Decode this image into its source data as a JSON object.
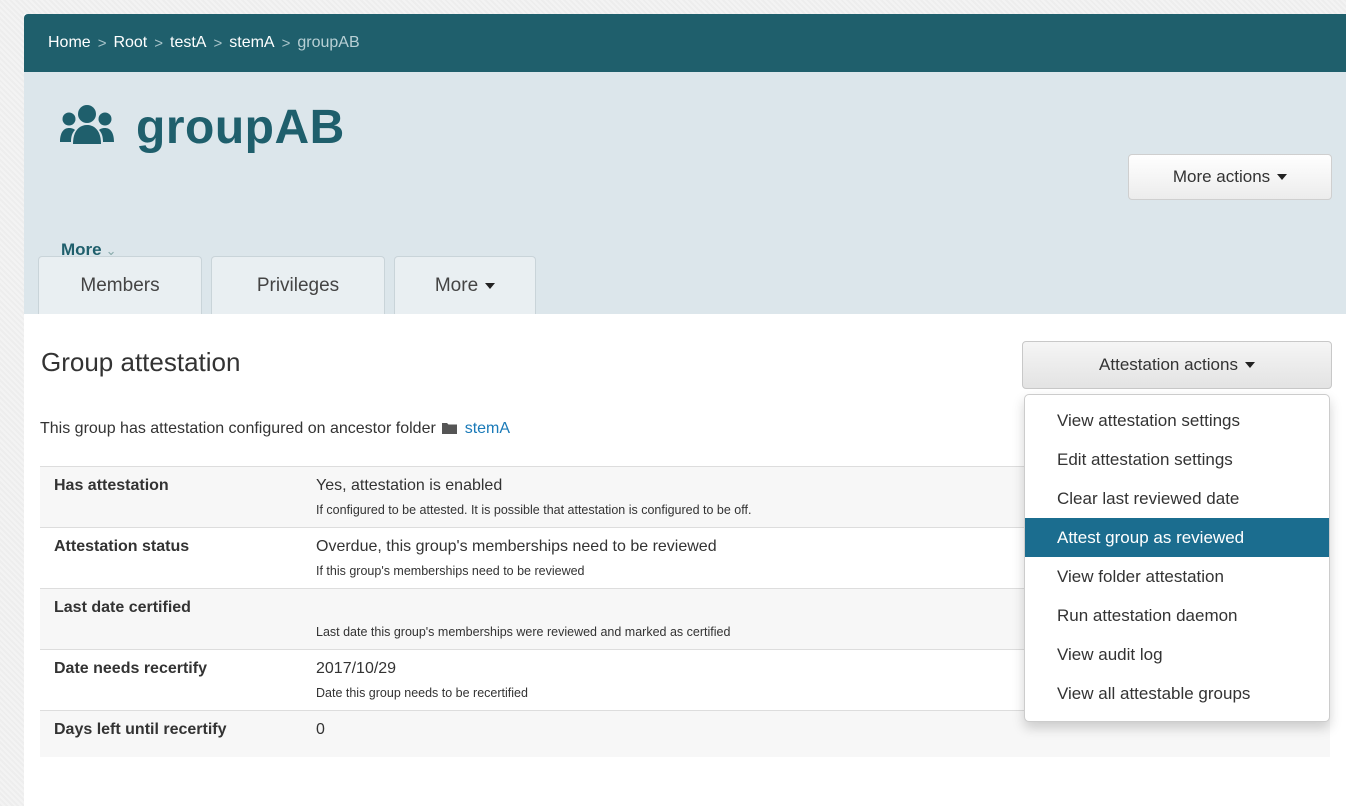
{
  "breadcrumb": {
    "items": [
      "Home",
      "Root",
      "testA",
      "stemA"
    ],
    "separator": ">",
    "current": "groupAB"
  },
  "header": {
    "title": "groupAB",
    "icon": "users-icon",
    "more_actions_label": "More actions",
    "more_link_label": "More"
  },
  "tabs": [
    "Members",
    "Privileges",
    "More"
  ],
  "main": {
    "section_title": "Group attestation",
    "actions_button_label": "Attestation actions",
    "description_prefix": "This group has attestation configured on ancestor folder",
    "description_folder_link": "stemA"
  },
  "attestation_table": [
    {
      "label": "Has attestation",
      "value": "Yes, attestation is enabled",
      "help": "If configured to be attested. It is possible that attestation is configured to be off."
    },
    {
      "label": "Attestation status",
      "value": "Overdue, this group's memberships need to be reviewed",
      "help": "If this group's memberships need to be reviewed"
    },
    {
      "label": "Last date certified",
      "value": "",
      "help": "Last date this group's memberships were reviewed and marked as certified"
    },
    {
      "label": "Date needs recertify",
      "value": "2017/10/29",
      "help": "Date this group needs to be recertified"
    },
    {
      "label": "Days left until recertify",
      "value": "0",
      "help": ""
    }
  ],
  "attestation_menu": {
    "items": [
      "View attestation settings",
      "Edit attestation settings",
      "Clear last reviewed date",
      "Attest group as reviewed",
      "View folder attestation",
      "Run attestation daemon",
      "View audit log",
      "View all attestable groups"
    ],
    "highlighted_index": 3
  },
  "colors": {
    "brand_dark": "#1f5f6c",
    "header_bg": "#dce6eb",
    "menu_highlight": "#1b6d8f",
    "link": "#1a7ab8"
  }
}
